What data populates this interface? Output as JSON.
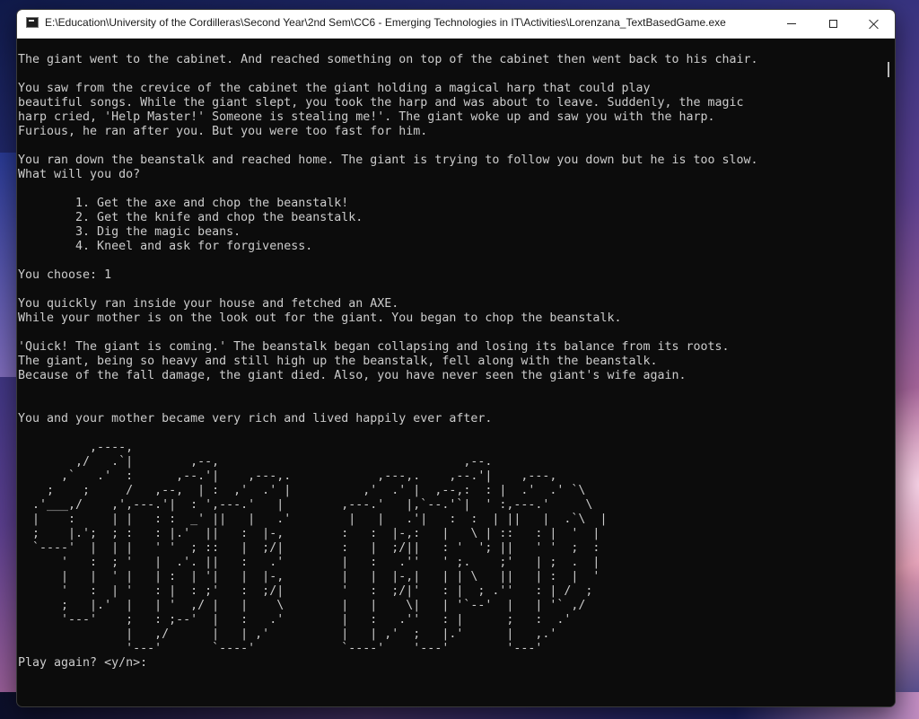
{
  "window": {
    "title": "E:\\Education\\University of the Cordilleras\\Second Year\\2nd Sem\\CC6 - Emerging Technologies in IT\\Activities\\Lorenzana_TextBasedGame.exe",
    "icon": "console-app-icon",
    "buttons": {
      "minimize": "minimize-icon",
      "maximize": "maximize-icon",
      "close": "close-icon"
    }
  },
  "console": {
    "text": "The giant went to the cabinet. And reached something on top of the cabinet then went back to his chair.\n\nYou saw from the crevice of the cabinet the giant holding a magical harp that could play\nbeautiful songs. While the giant slept, you took the harp and was about to leave. Suddenly, the magic\nharp cried, 'Help Master!' Someone is stealing me!'. The giant woke up and saw you with the harp.\nFurious, he ran after you. But you were too fast for him.\n\nYou ran down the beanstalk and reached home. The giant is trying to follow you down but he is too slow.\nWhat will you do?\n\n        1. Get the axe and chop the beanstalk!\n        2. Get the knife and chop the beanstalk.\n        3. Dig the magic beans.\n        4. Kneel and ask for forgiveness.\n\nYou choose: 1\n\nYou quickly ran inside your house and fetched an AXE.\nWhile your mother is on the look out for the giant. You began to chop the beanstalk.\n\n'Quick! The giant is coming.' The beanstalk began collapsing and losing its balance from its roots.\nThe giant, being so heavy and still high up the beanstalk, fell along with the beanstalk.\nBecause of the fall damage, the giant died. Also, you have never seen the giant's wife again.\n\n\nYou and your mother became very rich and lived happily ever after.\n",
    "ascii_art": "\n          ,----,\n        ,/   .`|        ,--,                                  ,--.\n      ,`   .'  :      ,--.'|    ,---,.            ,---,.    ,--.'|    ,---,\n    ;    ;     /   ,--,  | :  ,'  .' |          ,'  .' |  ,--,:  : |  .'  .' `\\\n  .'___,/    ,',---.'|  : ',---.'   |        ,---.'   |,`--.'`|  ' :,---.'     \\\n  |    :     | |   : :  _' ||   |   .'        |   |   .'|   :  :  | ||   |  .`\\  |\n  ;    |.';  ; :   : |.'  ||   :  |-,        :   :  |-,:   |   \\ | ::   : |  '  |\n  `----'  |  | |   ' '  ; ::   |  ;/|        :   |  ;/||   : '  '; ||   ' '  ;  :\n      '   :  ; '   |  .'. ||   :   .'        |   :   .''   ' ;.    ;'   | ;  .  |\n      |   |  ' |   | :  | '|   |  |-,        |   |  |-,|   | | \\   ||   | :  |  '\n      '   :  | '   : |  : ;'   :  ;/|        '   :  ;/|'   : |  ; .''   : | /  ;\n      ;   |.'  |   | '  ,/ |   |    \\        |   |    \\|   | '`--'  |   | '` ,/\n      '---'    ;   : ;--'  |   :   .'        |   :   .''   : |      ;   :  .'\n               |   ,/      |   | ,'          |   | ,'  ;   |.'      |   ,.'\n               '---'       `----'            `----'    '---'        '---'\n",
    "prompt": "Play again? <y/n>:"
  }
}
